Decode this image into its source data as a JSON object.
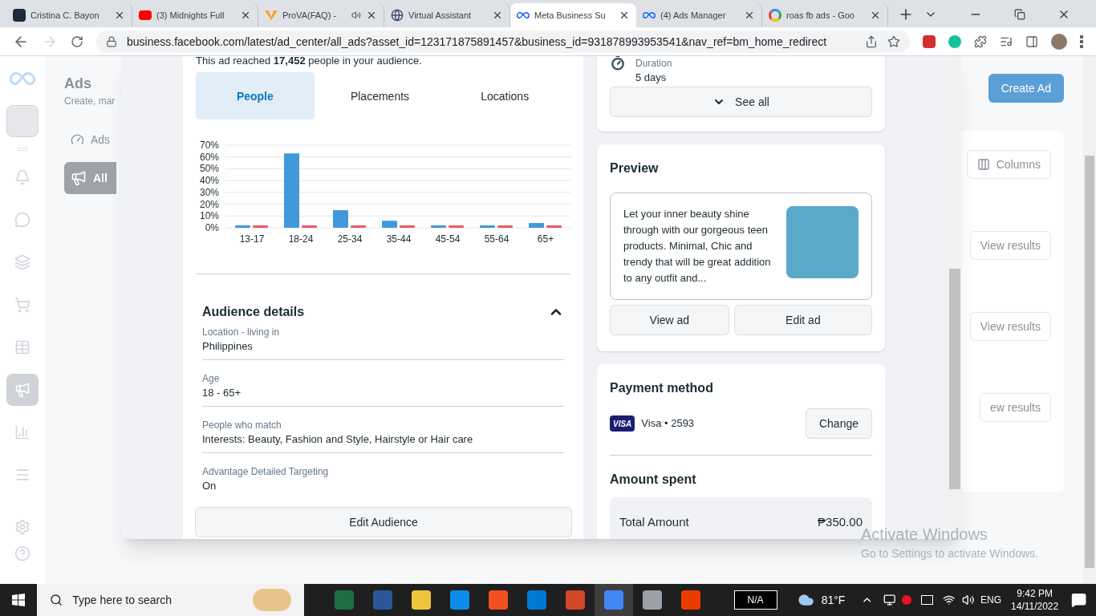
{
  "browser": {
    "tabs": [
      {
        "title": "Cristina C. Bayon",
        "selected": false,
        "kind": "profile"
      },
      {
        "title": "(3) Midnights Full",
        "selected": false,
        "kind": "video"
      },
      {
        "title": "ProVA(FAQ) -",
        "selected": false,
        "kind": "va",
        "audio": true
      },
      {
        "title": "Virtual Assistant",
        "selected": false,
        "kind": "globe"
      },
      {
        "title": "Meta Business Su",
        "selected": true,
        "kind": "meta"
      },
      {
        "title": "(4) Ads Manager",
        "selected": false,
        "kind": "meta"
      },
      {
        "title": "roas fb ads - Goo",
        "selected": false,
        "kind": "google"
      }
    ],
    "url": "business.facebook.com/latest/ad_center/all_ads?asset_id=123171875891457&business_id=931878993953541&nav_ref=bm_home_redirect"
  },
  "background": {
    "title": "Ads",
    "subtitle": "Create, mar",
    "nav": [
      {
        "label": "Ads",
        "selected": false
      },
      {
        "label": "All",
        "selected": true
      }
    ],
    "create_button": "Create Ad",
    "columns_button": "Columns",
    "view_results": [
      "View results",
      "View results",
      "ew results"
    ]
  },
  "sidebar": {
    "items": [
      {
        "selected": false
      },
      {
        "selected": false
      },
      {
        "selected": false
      },
      {
        "selected": false
      },
      {
        "selected": false
      },
      {
        "selected": true
      },
      {
        "selected": false
      },
      {
        "selected": false
      }
    ]
  },
  "audience": {
    "reach_text": "This ad reached **17,452** people in your audience.",
    "tabs": [
      {
        "label": "People",
        "selected": true
      },
      {
        "label": "Placements",
        "selected": false
      },
      {
        "label": "Locations",
        "selected": false
      }
    ],
    "chart_data": {
      "type": "bar",
      "categories": [
        "13-17",
        "18-24",
        "25-34",
        "35-44",
        "45-54",
        "55-64",
        "65+"
      ],
      "series": [
        {
          "color": "#4299d9",
          "values": [
            2,
            63,
            15,
            6,
            2,
            2,
            4
          ]
        },
        {
          "color": "#ec5b68",
          "values": [
            2,
            2,
            2,
            2,
            2,
            2,
            2
          ]
        }
      ],
      "ylim": [
        0,
        70
      ],
      "grid": true,
      "yticks": [
        {
          "value": 0,
          "label": "0%"
        },
        {
          "value": 10,
          "label": "10%"
        },
        {
          "value": 20,
          "label": "20%"
        },
        {
          "value": 30,
          "label": "30%"
        },
        {
          "value": 40,
          "label": "40%"
        },
        {
          "value": 50,
          "label": "50%"
        },
        {
          "value": 60,
          "label": "60%"
        },
        {
          "value": 70,
          "label": "70%"
        }
      ]
    },
    "details": {
      "title": "Audience details",
      "expanded": true,
      "fields": [
        {
          "label": "Location - living in",
          "value": "Philippines"
        },
        {
          "label": "Age",
          "value": "18 - 65+"
        },
        {
          "label": "People who match",
          "value": "Interests: Beauty, Fashion and Style, Hairstyle or Hair care"
        },
        {
          "label": "Advantage Detailed Targeting",
          "value": "On"
        }
      ]
    },
    "edit_button": "Edit Audience"
  },
  "schedule": {
    "label": "Duration",
    "value": "5 days",
    "see_all": "See all"
  },
  "preview": {
    "title": "Preview",
    "text": "Let your inner beauty shine through with our gorgeous teen products. Minimal, Chic and trendy that will be great addition to any outfit and...",
    "view_button": "View ad",
    "edit_button": "Edit ad"
  },
  "payment": {
    "title": "Payment method",
    "card_brand": "VISA",
    "card": "Visa • 2593",
    "change_button": "Change"
  },
  "amount": {
    "title": "Amount spent",
    "label": "Total Amount",
    "value": "₱350.00"
  },
  "activation": {
    "title": "Activate Windows",
    "text": "Go to Settings to activate Windows."
  },
  "taskbar": {
    "search_placeholder": "Type here to search",
    "battery": "N/A",
    "weather": "81°F",
    "language": "ENG",
    "time": "9:42 PM",
    "date": "14/11/2022"
  }
}
